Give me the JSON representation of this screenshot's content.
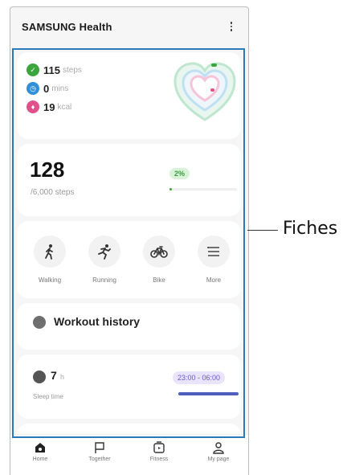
{
  "app": {
    "title": "SAMSUNG Health"
  },
  "activity": {
    "steps": {
      "value": "115",
      "unit": "steps",
      "color": "#3aa53a"
    },
    "mins": {
      "value": "0",
      "unit": "mins",
      "color": "#2f8fd8"
    },
    "kcal": {
      "value": "19",
      "unit": "kcal",
      "color": "#e0508a"
    }
  },
  "steps_card": {
    "count": "128",
    "goal": "/6,000 steps",
    "percent": "2%",
    "progress": 0.02
  },
  "workouts": [
    {
      "label": "Walking",
      "icon": "walking-icon"
    },
    {
      "label": "Running",
      "icon": "running-icon"
    },
    {
      "label": "Bike",
      "icon": "bike-icon"
    },
    {
      "label": "More",
      "icon": "list-icon"
    }
  ],
  "history": {
    "title": "Workout history"
  },
  "sleep": {
    "value": "7",
    "unit": "h",
    "label": "Sleep time",
    "range": "23:00 - 06:00"
  },
  "nav": [
    {
      "label": "Home",
      "icon": "home-icon"
    },
    {
      "label": "Together",
      "icon": "flag-icon"
    },
    {
      "label": "Fitness",
      "icon": "fitness-icon"
    },
    {
      "label": "My page",
      "icon": "person-icon"
    }
  ],
  "callout": {
    "label": "Fiches"
  }
}
